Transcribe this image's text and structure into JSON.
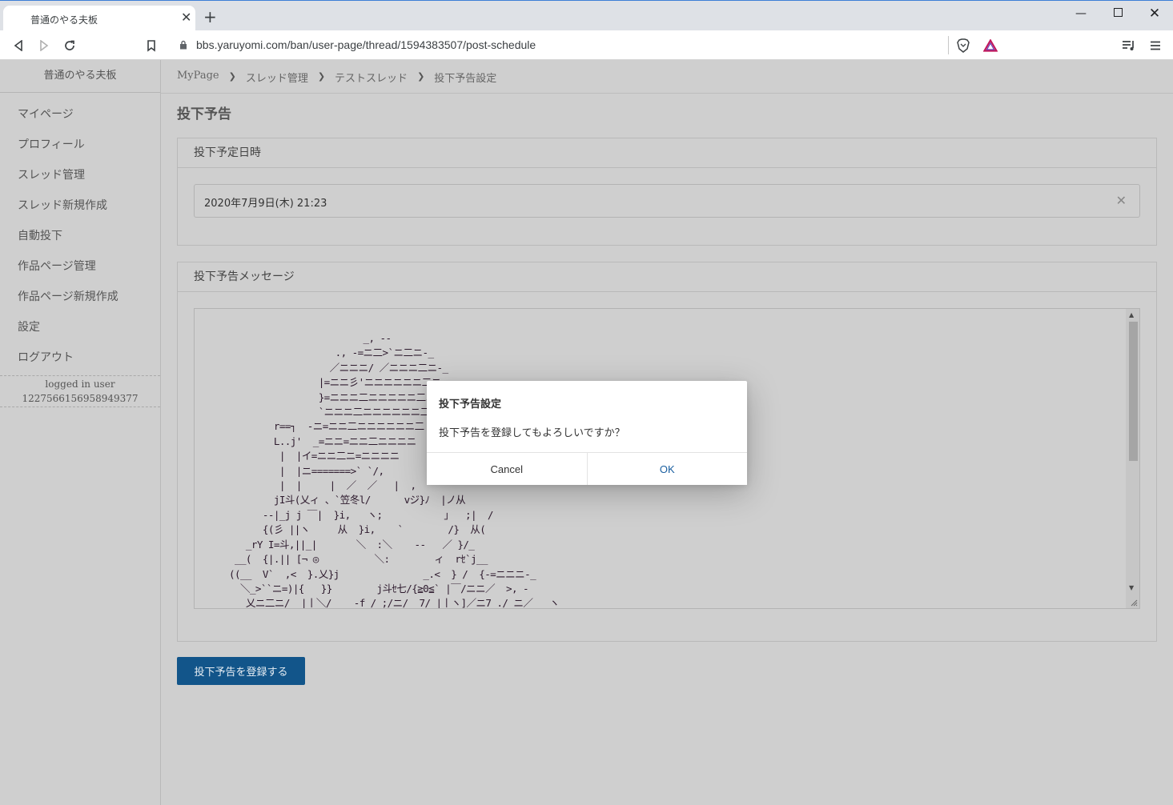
{
  "browser": {
    "tab_title": "普通のやる夫板",
    "tab_close": "✕",
    "new_tab": "+",
    "url": "bbs.yaruyomi.com/ban/user-page/thread/1594383507/post-schedule"
  },
  "sidebar": {
    "site_name": "普通のやる夫板",
    "items": [
      {
        "label": "マイページ"
      },
      {
        "label": "プロフィール"
      },
      {
        "label": "スレッド管理"
      },
      {
        "label": "スレッド新規作成"
      },
      {
        "label": "自動投下"
      },
      {
        "label": "作品ページ管理"
      },
      {
        "label": "作品ページ新規作成"
      },
      {
        "label": "設定"
      },
      {
        "label": "ログアウト"
      }
    ],
    "logged_in_label": "logged in user",
    "user_id": "1227566156958949377"
  },
  "breadcrumb": [
    "MyPage",
    "スレッド管理",
    "テストスレッド",
    "投下予告設定"
  ],
  "page_title": "投下予告",
  "schedule_card": {
    "header": "投下予定日時",
    "date_value": "2020年7月9日(木) 21:23",
    "clear_symbol": "✕"
  },
  "message_card": {
    "header": "投下予告メッセージ",
    "ascii_art": "                         _, --\n                    ., -=ニ二>`ニ二ニ-_\n                   ／ニニニ/ ／ニニニ二ニ-_\n                 |=ニニ彡'ニニニニニニ二ニ-_\n                 }=ニニニ二ニニニニニ二ニ-\n                 `ニニニ二ニニニニニニ二ニ\n         r==┐  -ニ=ニニ二ニニニニニニ二\n         L..j'  _=ニニ=ニニ二ニニニニ\n          |  |イ=ニニ二ニ=ニニニニ\n          |  |ニ=======>` `/,  \n          |  |     |  ／  ／   |  ,\n         jI斗(乂ィ 、`笠冬l/      vジ}ﾉ  |ノ从\n       --|_j j ￣|  }i,   ヽ;           ｣   ;|  /\n       {(彡 ||ヽ     从  }i,    `        /}  从(\n    _rY I=斗,||_|       ＼  :＼    --   ／ }/_\n  __(  {|.|| [¬ ◎          ＼:        ィ  rｾ`j__\n ((__  V`  ,<  }.乂}j               _.<  } /  {-=ニニニ-_\n   ＼_>``ニ=)|{   }}        j斗ｾ七/{≧0≦` |￣/ニニ／  >, -\n    乂ニ二ニ/  |丨＼/    -f / ;/ニ/  7/ |丨ヽ]／ニ7 ./ ニ／   ヽ\n    |ニ二ニl     ` `       /l  l | /ニ /  ///ll: `ニ=/ ニ／ /    ,"
  },
  "submit_label": "投下予告を登録する",
  "dialog": {
    "title": "投下予告設定",
    "message": "投下予告を登録してもよろしいですか？",
    "cancel": "Cancel",
    "ok": "OK"
  },
  "colors": {
    "primary": "#12558a",
    "background": "#cfcfcf",
    "brave_accent": "#fb542b"
  }
}
